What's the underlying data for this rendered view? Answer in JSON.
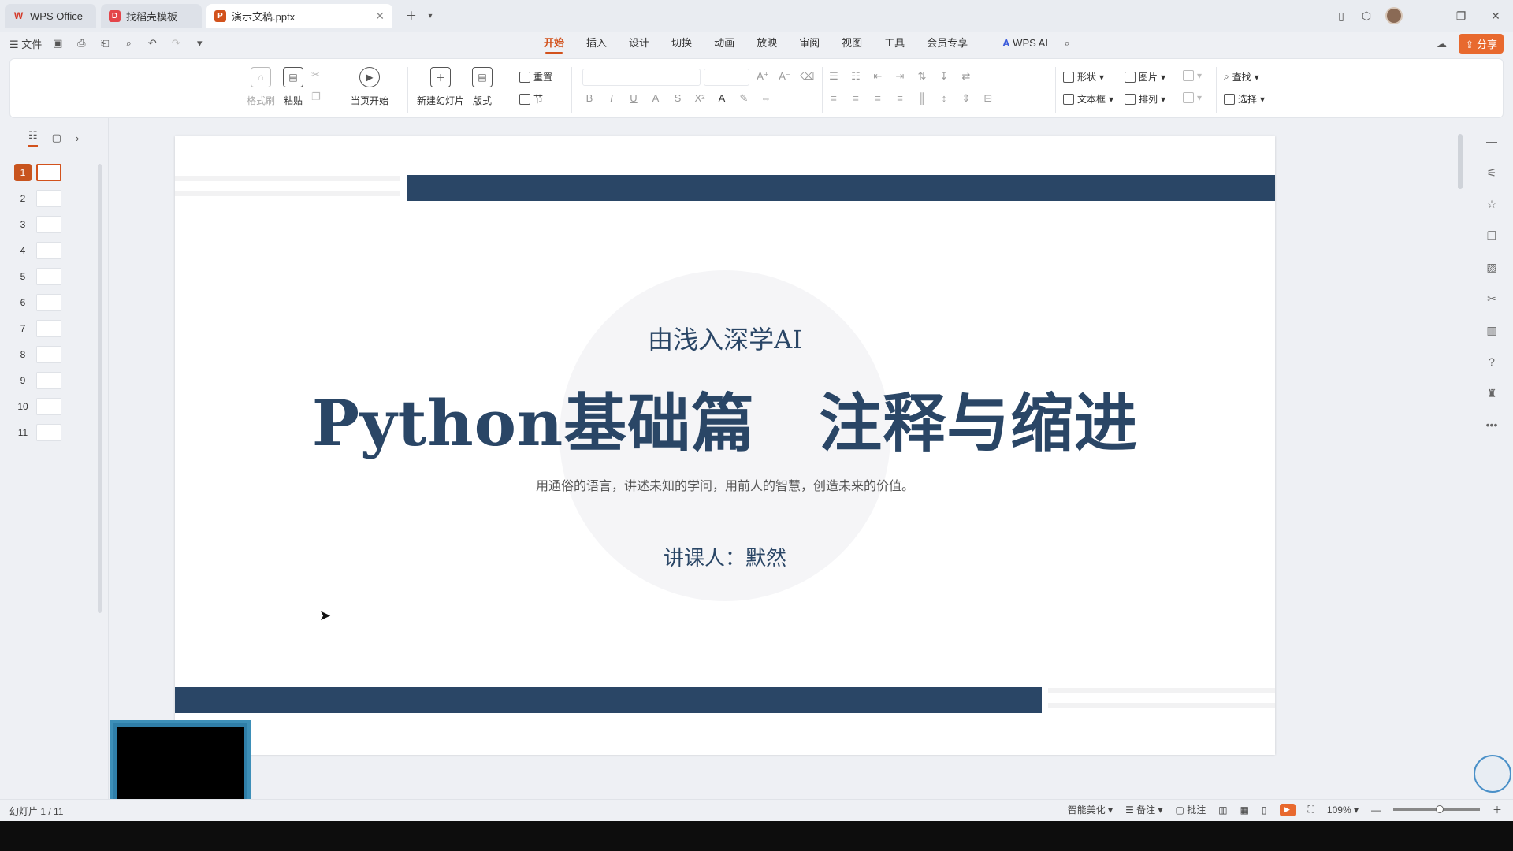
{
  "tabs": [
    {
      "label": "WPS Office",
      "icon": "wps-logo-icon",
      "color": "#d43c2c"
    },
    {
      "label": "找稻壳模板",
      "icon": "docer-icon",
      "color": "#e4454a"
    },
    {
      "label": "演示文稿.pptx",
      "icon": "ppt-icon",
      "color": "#d2521c"
    }
  ],
  "menu": {
    "file": "文件",
    "tabs": [
      "开始",
      "插入",
      "设计",
      "切换",
      "动画",
      "放映",
      "审阅",
      "视图",
      "工具",
      "会员专享"
    ],
    "active_tab": "开始",
    "wps_ai": "WPS AI",
    "share": "分享"
  },
  "ribbon": {
    "format_painter": "格式刷",
    "paste": "粘贴",
    "play_from_current": "当页开始",
    "new_slide": "新建幻灯片",
    "layout": "版式",
    "reset": "重置",
    "section": "节",
    "shape": "形状",
    "picture": "图片",
    "textbox": "文本框",
    "arrange": "排列",
    "find": "查找",
    "select": "选择"
  },
  "thumbnails": [
    "1",
    "2",
    "3",
    "4",
    "5",
    "6",
    "7",
    "8",
    "9",
    "10",
    "11"
  ],
  "slide": {
    "subtitle": "由浅入深学AI",
    "title": "Python基础篇　注释与缩进",
    "description": "用通俗的语言，讲述未知的学问，用前人的智慧，创造未来的价值。",
    "lecturer": "讲课人：默然",
    "accent_color": "#2a4666"
  },
  "status": {
    "slide_counter": "幻灯片 1 / 11",
    "smart_beautify": "智能美化",
    "notes": "备注",
    "comments": "批注",
    "zoom": "109%"
  }
}
